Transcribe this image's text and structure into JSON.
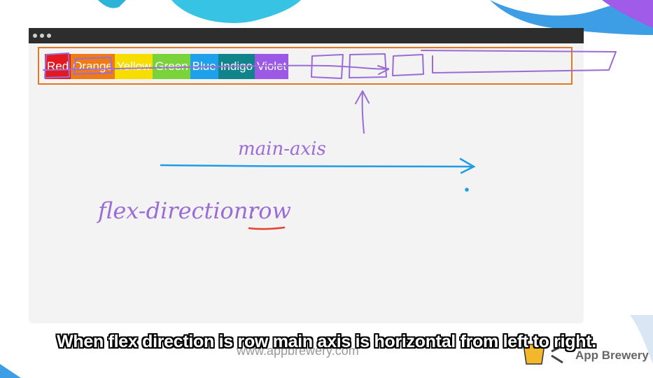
{
  "browser": {
    "window_dots": [
      "dot-1",
      "dot-2",
      "dot-3"
    ]
  },
  "flex_items": [
    {
      "label": "Red",
      "color": "#e3191f"
    },
    {
      "label": "Orange",
      "color": "#f07b14"
    },
    {
      "label": "Yellow",
      "color": "#f7de00"
    },
    {
      "label": "Green",
      "color": "#7ad33a"
    },
    {
      "label": "Blue",
      "color": "#1ea1ea"
    },
    {
      "label": "Indigo",
      "color": "#10848a"
    },
    {
      "label": "Violet",
      "color": "#9b59e6"
    }
  ],
  "annotations": {
    "axis_label": "main-axis",
    "property_label": "flex-direction:",
    "property_value": "row"
  },
  "caption": "When flex direction is row main axis is horizontal from left to right.",
  "footer": {
    "site": "www.appbrewery.com",
    "brand": "App Brewery"
  },
  "colors": {
    "container_border": "#e07a22",
    "sketch": "#9b6bd6",
    "axis_arrow": "#1e9ce6",
    "underline": "#e8412e"
  }
}
